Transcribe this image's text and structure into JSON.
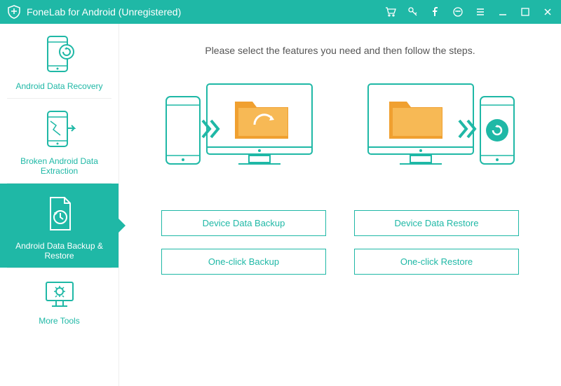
{
  "app": {
    "title": "FoneLab for Android (Unregistered)"
  },
  "sidebar": {
    "items": [
      {
        "label": "Android Data Recovery"
      },
      {
        "label": "Broken Android Data Extraction"
      },
      {
        "label": "Android Data Backup & Restore"
      },
      {
        "label": "More Tools"
      }
    ]
  },
  "main": {
    "instruction": "Please select the features you need and then follow the steps.",
    "buttons": {
      "device_backup": "Device Data Backup",
      "device_restore": "Device Data Restore",
      "oneclick_backup": "One-click Backup",
      "oneclick_restore": "One-click Restore"
    }
  },
  "colors": {
    "accent": "#1fb8a6",
    "orange": "#f0a030"
  }
}
